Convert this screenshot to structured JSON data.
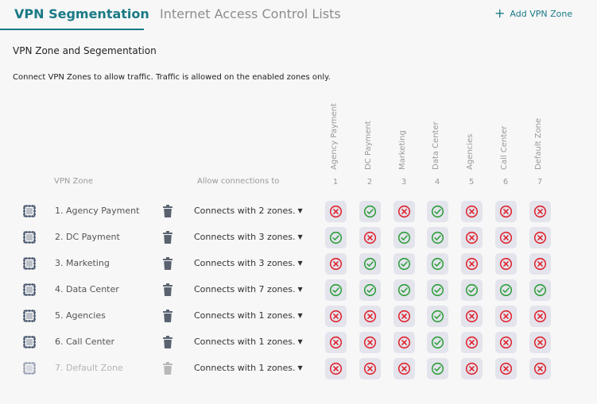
{
  "tabs": {
    "active": "VPN Segmentation",
    "inactive": "Internet Access Control Lists"
  },
  "add_zone_label": "Add VPN Zone",
  "section_title": "VPN Zone and Segementation",
  "description": "Connect VPN Zones to allow traffic. Traffic is allowed on the enabled zones only.",
  "table": {
    "col_vpn_zone": "VPN Zone",
    "col_allow": "Allow connections to",
    "zone_headers": [
      {
        "name": "Agency Payment",
        "num": "1"
      },
      {
        "name": "DC Payment",
        "num": "2"
      },
      {
        "name": "Marketing",
        "num": "3"
      },
      {
        "name": "Data Center",
        "num": "4"
      },
      {
        "name": "Agencies",
        "num": "5"
      },
      {
        "name": "Call Center",
        "num": "6"
      },
      {
        "name": "Default Zone",
        "num": "7"
      }
    ],
    "rows": [
      {
        "label": "1.  Agency Payment",
        "connects": "Connects with 2 zones.",
        "disabled": false,
        "cells": [
          0,
          1,
          0,
          1,
          0,
          0,
          0
        ]
      },
      {
        "label": "2.  DC Payment",
        "connects": "Connects with 3 zones.",
        "disabled": false,
        "cells": [
          1,
          0,
          1,
          1,
          0,
          0,
          0
        ]
      },
      {
        "label": "3.  Marketing",
        "connects": "Connects with 3 zones.",
        "disabled": false,
        "cells": [
          0,
          1,
          1,
          1,
          0,
          0,
          0
        ]
      },
      {
        "label": "4.  Data Center",
        "connects": "Connects with 7 zones.",
        "disabled": false,
        "cells": [
          1,
          1,
          1,
          1,
          1,
          1,
          1
        ]
      },
      {
        "label": "5.  Agencies",
        "connects": "Connects with 1 zones.",
        "disabled": false,
        "cells": [
          0,
          0,
          0,
          1,
          0,
          0,
          0
        ]
      },
      {
        "label": "6.  Call Center",
        "connects": "Connects with 1 zones.",
        "disabled": false,
        "cells": [
          0,
          0,
          0,
          1,
          0,
          0,
          0
        ]
      },
      {
        "label": "7.  Default Zone",
        "connects": "Connects with 1 zones.",
        "disabled": true,
        "cells": [
          0,
          0,
          0,
          1,
          0,
          0,
          0
        ]
      }
    ]
  },
  "colors": {
    "accent": "#1a7a86",
    "allowed": "#2e9e3a",
    "blocked": "#e0232e",
    "cell_bg": "#e3e4ec"
  },
  "icons": {
    "add": "plus-icon",
    "drag": "drag-handle-icon",
    "delete": "trash-icon",
    "dropdown": "caret-down-icon",
    "allowed": "check-circle-icon",
    "blocked": "x-circle-icon"
  }
}
